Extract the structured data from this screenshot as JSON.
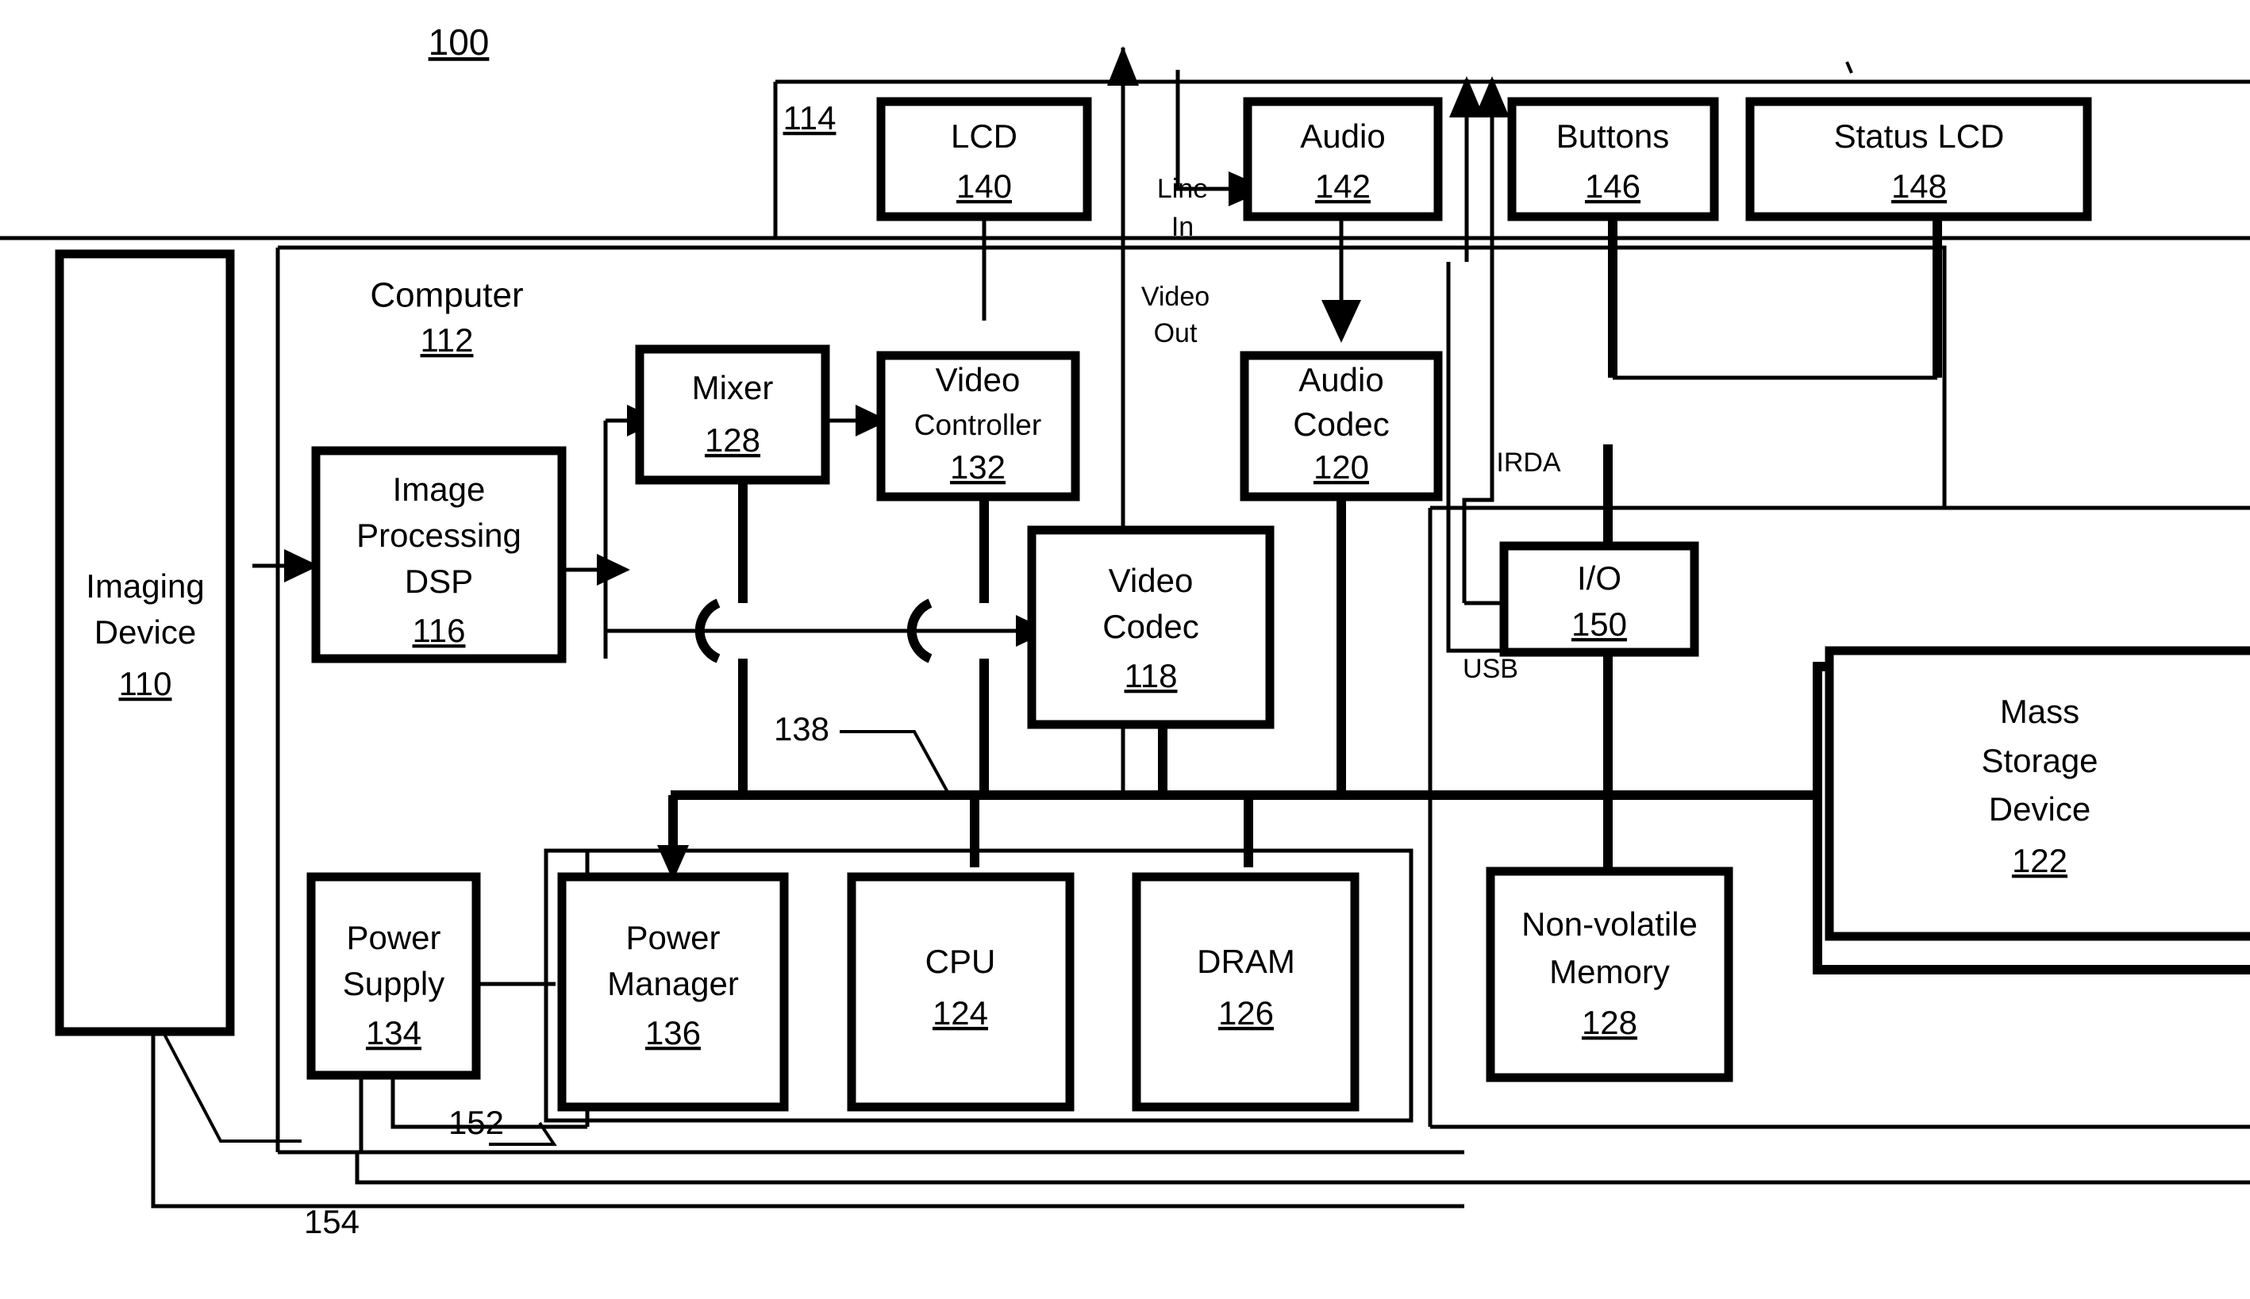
{
  "figure": {
    "figure_ref": "100",
    "type": "patent-block-diagram"
  },
  "groups": [
    {
      "key": "peripherals",
      "ref": "114",
      "label": ""
    },
    {
      "key": "computer",
      "title": "Computer",
      "ref": "112"
    }
  ],
  "blocks": {
    "lcd": {
      "name": "LCD",
      "ref": "140"
    },
    "audio": {
      "name": "Audio",
      "ref": "142"
    },
    "buttons": {
      "name": "Buttons",
      "ref": "146"
    },
    "status_lcd": {
      "name": "Status LCD",
      "ref": "148"
    },
    "imaging_device": {
      "line1": "Imaging",
      "line2": "Device",
      "ref": "110"
    },
    "dsp": {
      "line1": "Image",
      "line2": "Processing",
      "line3": "DSP",
      "ref": "116"
    },
    "mixer": {
      "name": "Mixer",
      "ref": "128"
    },
    "video_ctrl": {
      "line1": "Video",
      "line2": "Controller",
      "ref": "132"
    },
    "audio_codec": {
      "line1": "Audio",
      "line2": "Codec",
      "ref": "120"
    },
    "video_codec": {
      "line1": "Video",
      "line2": "Codec",
      "ref": "118"
    },
    "io": {
      "name": "I/O",
      "ref": "150"
    },
    "mass_storage": {
      "line1": "Mass",
      "line2": "Storage",
      "line3": "Device",
      "ref": "122"
    },
    "power_supply": {
      "line1": "Power",
      "line2": "Supply",
      "ref": "134"
    },
    "power_manager": {
      "line1": "Power",
      "line2": "Manager",
      "ref": "136"
    },
    "cpu": {
      "name": "CPU",
      "ref": "124"
    },
    "dram": {
      "name": "DRAM",
      "ref": "126"
    },
    "nvmem": {
      "line1": "Non-volatile",
      "line2": "Memory",
      "ref": "128"
    }
  },
  "signal_labels": {
    "line_in_1": "Line",
    "line_in_2": "In",
    "video_out_1": "Video",
    "video_out_2": "Out",
    "irda": "IRDA",
    "usb": "USB"
  },
  "reference_numerals": {
    "bus_138": "138",
    "power_152": "152",
    "outer_154": "154",
    "group_114": "114",
    "computer_112": "112"
  },
  "colors": {
    "ink": "#000000",
    "paper": "#ffffff"
  }
}
